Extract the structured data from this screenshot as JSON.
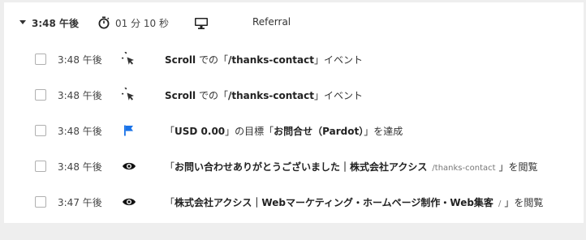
{
  "session": {
    "time": "3:48 午後",
    "duration": "01 分 10 秒",
    "source": "Referral"
  },
  "events": [
    {
      "time": "3:48 午後",
      "icon": "pointer-click-icon",
      "bold1": "Scroll",
      "text1": " での「",
      "bold2": "/thanks-contact",
      "text2": "」イベント",
      "path": "",
      "text3": ""
    },
    {
      "time": "3:48 午後",
      "icon": "pointer-click-icon",
      "bold1": "Scroll",
      "text1": " での「",
      "bold2": "/thanks-contact",
      "text2": "」イベント",
      "path": "",
      "text3": ""
    },
    {
      "time": "3:48 午後",
      "icon": "flag-icon",
      "bold1": "",
      "text1": "「",
      "bold2": "USD 0.00",
      "text2": "」の目標「",
      "path": "",
      "bold3": "お問合せ（Pardot）",
      "text3": "」を達成"
    },
    {
      "time": "3:48 午後",
      "icon": "eye-icon",
      "bold1": "",
      "text1": "「",
      "bold2": "お問い合わせありがとうございました｜株式会社アクシス",
      "text2": "",
      "path": "/thanks-contact",
      "text3": "」を閲覧"
    },
    {
      "time": "3:47 午後",
      "icon": "eye-icon",
      "bold1": "",
      "text1": "「",
      "bold2": "株式会社アクシス｜Webマーケティング・ホームページ制作・Web集客",
      "text2": "",
      "path": "/",
      "text3": "」を閲覧"
    }
  ],
  "colors": {
    "flag": "#1a73e8",
    "eye": "#111111",
    "pointer": "#333333"
  }
}
